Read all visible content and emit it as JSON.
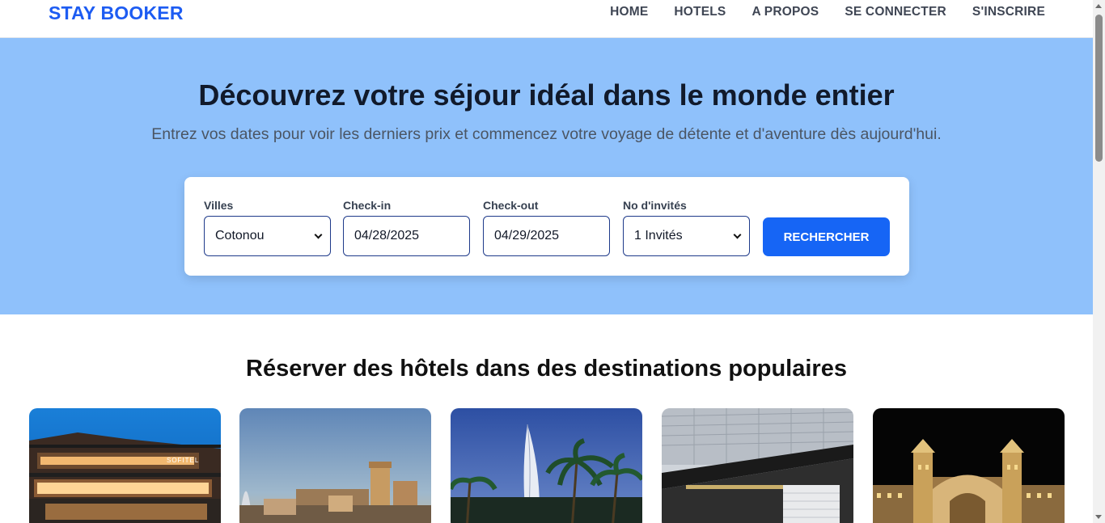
{
  "brand": {
    "name": "STAY BOOKER"
  },
  "nav": {
    "items": [
      {
        "label": "HOME"
      },
      {
        "label": "HOTELS"
      },
      {
        "label": "A PROPOS"
      },
      {
        "label": "SE CONNECTER"
      },
      {
        "label": "S'INSCRIRE"
      }
    ]
  },
  "hero": {
    "title": "Découvrez votre séjour idéal dans le monde entier",
    "subtitle": "Entrez vos dates pour voir les derniers prix et commencez votre voyage de détente et d'aventure dès aujourd'hui."
  },
  "search": {
    "city": {
      "label": "Villes",
      "value": "Cotonou"
    },
    "checkin": {
      "label": "Check-in",
      "value": "04/28/2025"
    },
    "checkout": {
      "label": "Check-out",
      "value": "04/29/2025"
    },
    "guests": {
      "label": "No d'invités",
      "value": "1 Invités"
    },
    "button_label": "RECHERCHER"
  },
  "destinations": {
    "title": "Réserver des hôtels dans des destinations populaires",
    "cards": [
      {
        "image": "hotel-sofitel-night",
        "sign": "SOFITEL"
      },
      {
        "image": "hotel-madinat-dusk"
      },
      {
        "image": "hotel-burj-al-arab-palms"
      },
      {
        "image": "hotel-modern-facade"
      },
      {
        "image": "hotel-atlantis-night"
      }
    ]
  },
  "colors": {
    "brand": "#1d5cf2",
    "hero_bg": "#8fc1fb",
    "button_bg": "#1665f5",
    "field_border": "#1e3a8a"
  }
}
